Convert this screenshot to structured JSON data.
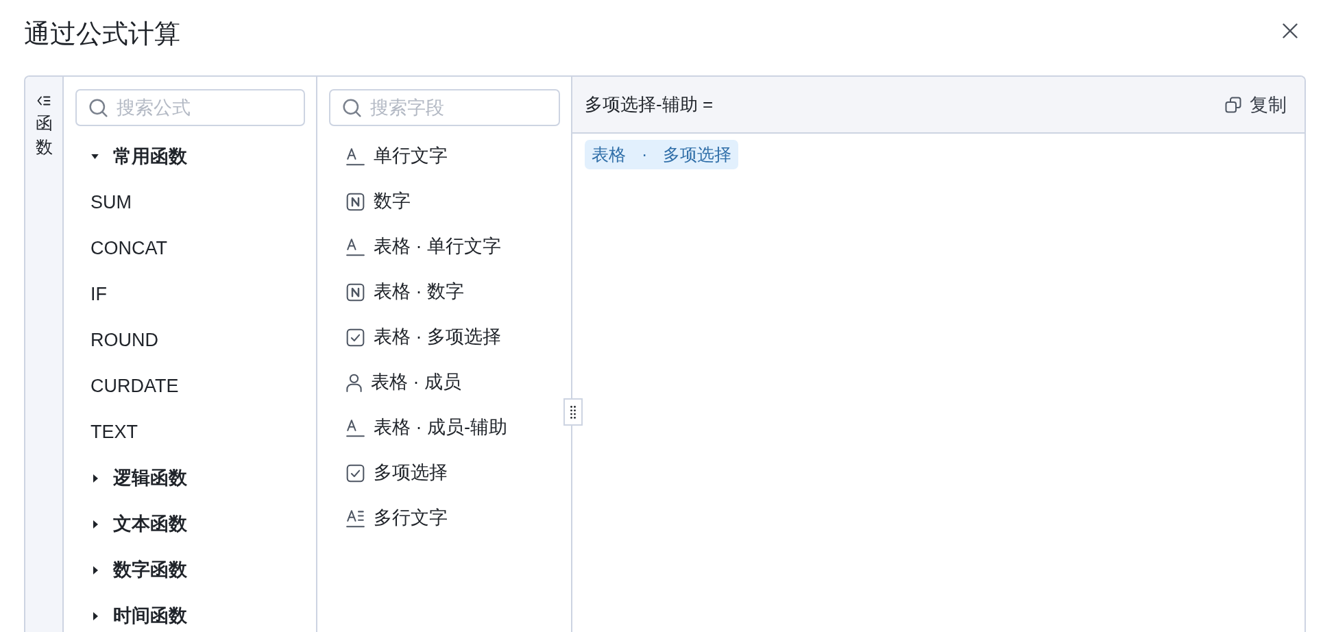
{
  "dialog": {
    "title": "通过公式计算"
  },
  "sidebar_tab": {
    "label": "函数"
  },
  "functions": {
    "search": {
      "placeholder": "搜索公式"
    },
    "groups": [
      {
        "label": "常用函数",
        "expanded": true,
        "children": [
          {
            "label": "SUM"
          },
          {
            "label": "CONCAT"
          },
          {
            "label": "IF"
          },
          {
            "label": "ROUND"
          },
          {
            "label": "CURDATE"
          },
          {
            "label": "TEXT"
          }
        ]
      },
      {
        "label": "逻辑函数",
        "expanded": false
      },
      {
        "label": "文本函数",
        "expanded": false
      },
      {
        "label": "数字函数",
        "expanded": false
      },
      {
        "label": "时间函数",
        "expanded": false
      }
    ]
  },
  "fields": {
    "search": {
      "placeholder": "搜索字段"
    },
    "items": [
      {
        "label": "单行文字",
        "kind": "text"
      },
      {
        "label": "数字",
        "kind": "number"
      },
      {
        "label": "表格 · 单行文字",
        "kind": "text"
      },
      {
        "label": "表格 · 数字",
        "kind": "number"
      },
      {
        "label": "表格 · 多项选择",
        "kind": "checkbox"
      },
      {
        "label": "表格 · 成员",
        "kind": "member"
      },
      {
        "label": "表格 · 成员-辅助",
        "kind": "text"
      },
      {
        "label": "多项选择",
        "kind": "checkbox"
      },
      {
        "label": "多行文字",
        "kind": "multiline"
      }
    ]
  },
  "editor": {
    "target": "多项选择-辅助 =",
    "copy_label": "复制",
    "tokens": [
      {
        "label": "表格 · 多项选择"
      }
    ]
  }
}
